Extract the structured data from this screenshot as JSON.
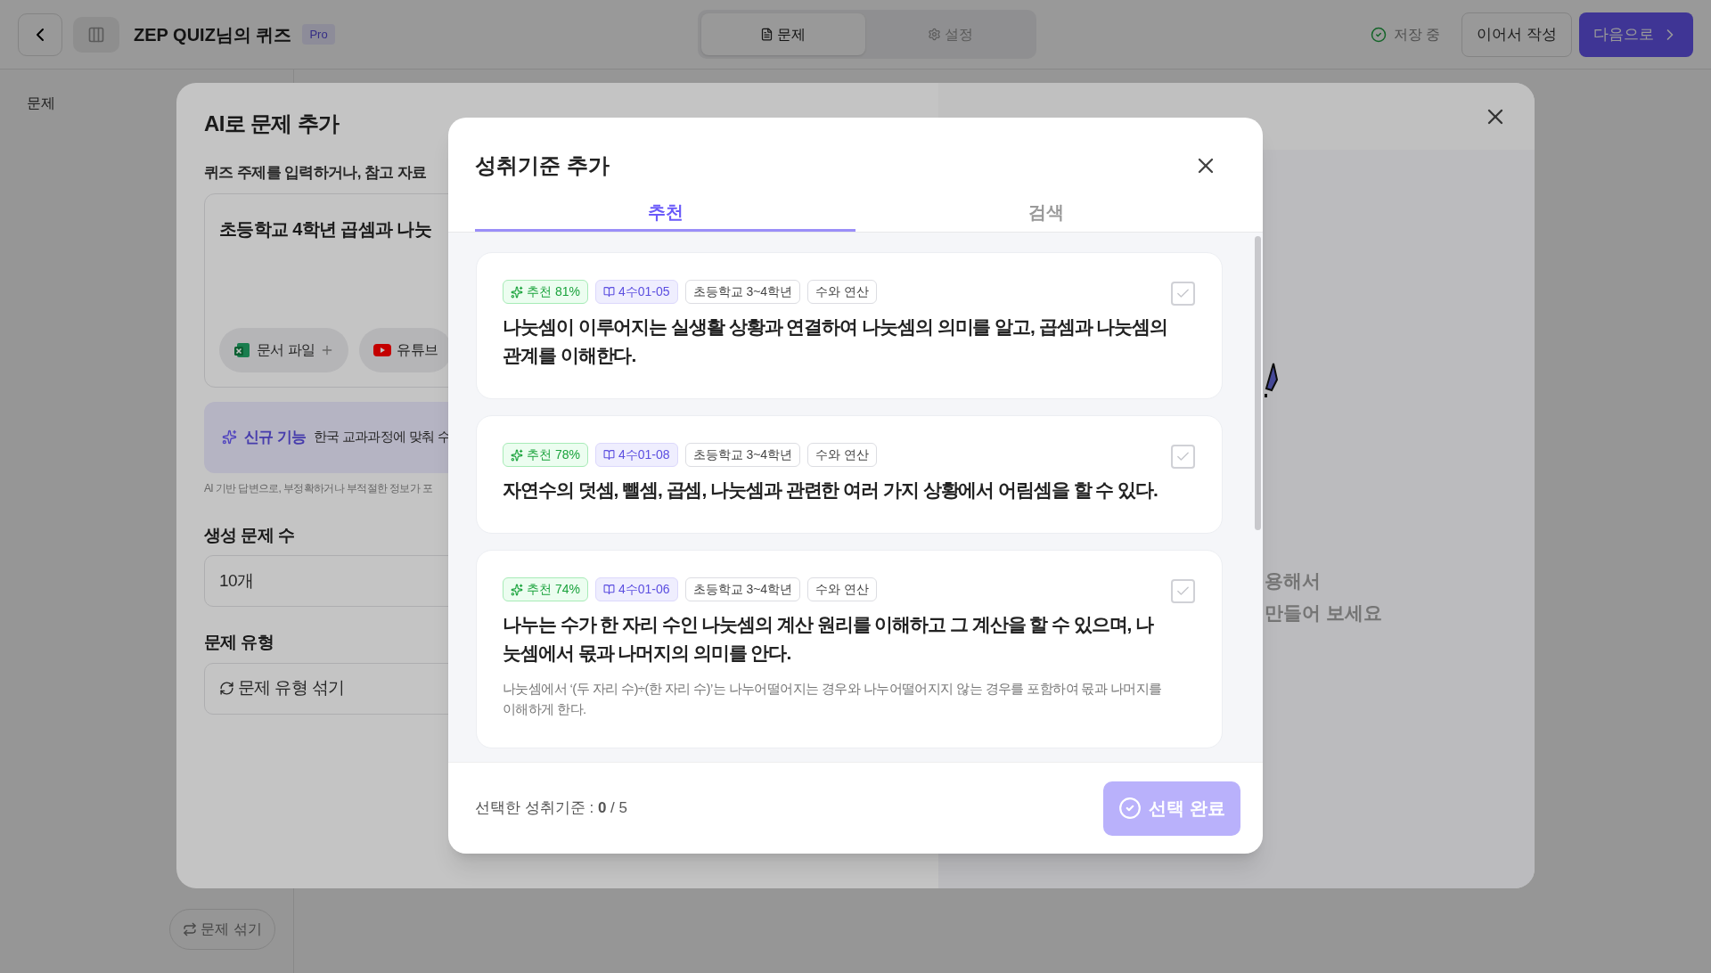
{
  "topbar": {
    "title": "ZEP QUIZ님의 퀴즈",
    "badge": "Pro",
    "tabs": [
      {
        "label": "문제",
        "kind": "doc",
        "selected": true
      },
      {
        "label": "설정",
        "kind": "gear",
        "selected": false
      }
    ],
    "save_status": "저장 중",
    "buttons": [
      {
        "label": "이어서 작성",
        "kind": "secondary"
      },
      {
        "label": "다음으로",
        "kind": "primary"
      }
    ]
  },
  "sidebar": {
    "label": "문제"
  },
  "shuffle_button": "문제 섞기",
  "ai_modal": {
    "title": "AI로 문제 추가",
    "prompt_label": "퀴즈 주제를 입력하거나, 참고 자료",
    "prompt_value": "초등학교 4학년 곱셈과 나눗",
    "attachments": [
      {
        "label": "문서 파일",
        "kind": "file"
      },
      {
        "label": "유튜브",
        "kind": "youtube"
      }
    ],
    "banner": {
      "badge": "신규 기능",
      "text": "한국 교과과정에 맞춰 수"
    },
    "disclaimer": "AI 기반 답변으로, 부정확하거나 부적절한 정보가 포",
    "count": {
      "label": "생성 문제 수",
      "value": "10개"
    },
    "type": {
      "label": "문제 유형",
      "value": "문제 유형 섞기"
    },
    "hint_lines": [
      "용해서",
      "만들어 보세요"
    ]
  },
  "dialog": {
    "title": "성취기준 추가",
    "tabs": [
      {
        "label": "추천",
        "selected": true
      },
      {
        "label": "검색",
        "selected": false
      }
    ],
    "standards": [
      {
        "score": "추천 81%",
        "code": "4수01-05",
        "grade": "초등학교 3~4학년",
        "area": "수와 연산",
        "text": "나눗셈이 이루어지는 실생활 상황과 연결하여 나눗셈의 의미를 알고, 곱셈과 나눗셈의 관계를 이해한다.",
        "checked": false
      },
      {
        "score": "추천 78%",
        "code": "4수01-08",
        "grade": "초등학교 3~4학년",
        "area": "수와 연산",
        "text": "자연수의 덧셈, 뺄셈, 곱셈, 나눗셈과 관련한 여러 가지 상황에서 어림셈을 할 수 있다.",
        "checked": false
      },
      {
        "score": "추천 74%",
        "code": "4수01-06",
        "grade": "초등학교 3~4학년",
        "area": "수와 연산",
        "text": "나누는 수가 한 자리 수인 나눗셈의 계산 원리를 이해하고 그 계산을 할 수 있으며, 나눗셈에서 몫과 나머지의 의미를 안다.",
        "description": "나눗셈에서 ‘(두 자리 수)÷(한 자리 수)’는 나누어떨어지는 경우와 나누어떨어지지 않는 경우를 포함하여 몫과 나머지를 이해하게 한다.",
        "checked": false
      }
    ],
    "footer": "선택한 성취기준 : **0** / 5",
    "confirm": {
      "label": "선택 완료",
      "disabled": true
    }
  }
}
